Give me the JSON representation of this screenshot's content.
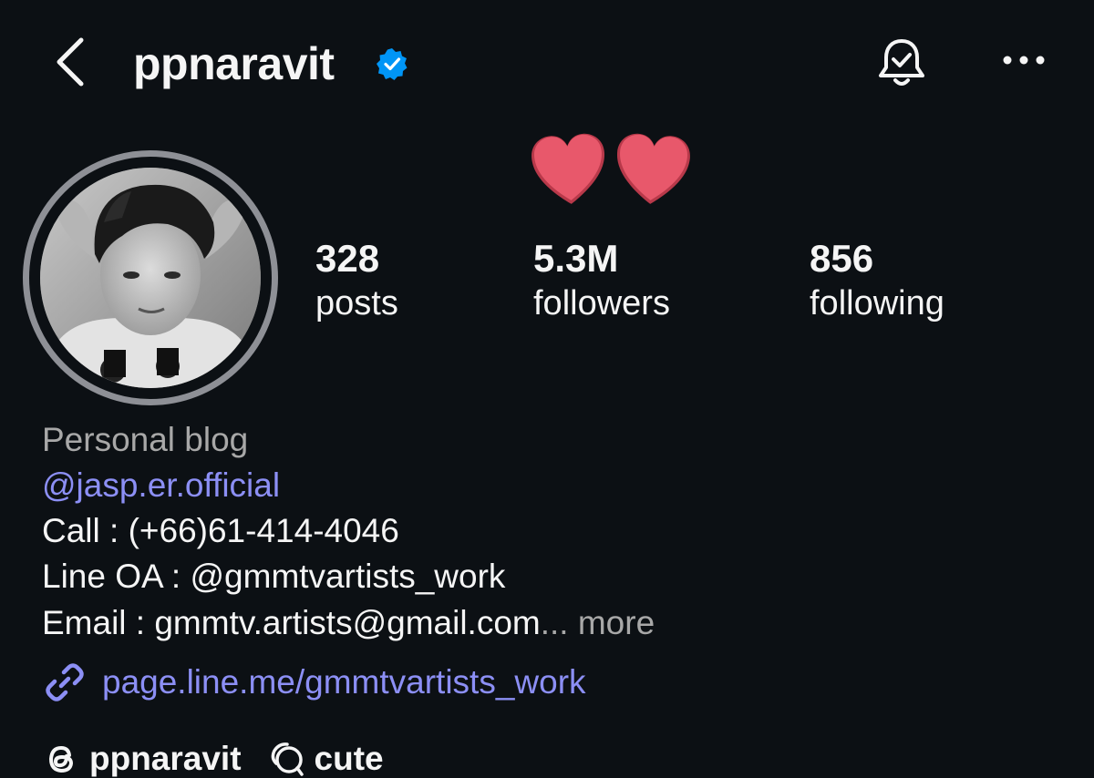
{
  "header": {
    "username": "ppnaravit"
  },
  "icons": {
    "back": "chevron-left-icon",
    "verified": "verified-badge-icon",
    "notifications": "bell-check-icon",
    "more": "more-horizontal-icon",
    "note": "two-hearts-icon",
    "link": "link-icon",
    "threads": "threads-icon",
    "chat": "chat-bubble-icon"
  },
  "colors": {
    "background": "#0c1014",
    "text": "#f5f5f5",
    "muted": "#a8a8a8",
    "link": "#8c8ff5",
    "verified": "#0095f6",
    "heart": "#e74c5e"
  },
  "stats": {
    "posts": {
      "count": "328",
      "label": "posts"
    },
    "followers": {
      "count": "5.3M",
      "label": "followers"
    },
    "following": {
      "count": "856",
      "label": "following"
    }
  },
  "bio": {
    "category": "Personal blog",
    "mention": "@jasp.er.official",
    "call": "Call : (+66)61-414-4046",
    "line_oa": "Line OA : @gmmtvartists_work",
    "email": "Email : gmmtv.artists@gmail.com",
    "ellipsis": "...",
    "more": "more",
    "link": "page.line.me/gmmtvartists_work"
  },
  "chips": {
    "threads": "ppnaravit",
    "channel": "cute"
  }
}
